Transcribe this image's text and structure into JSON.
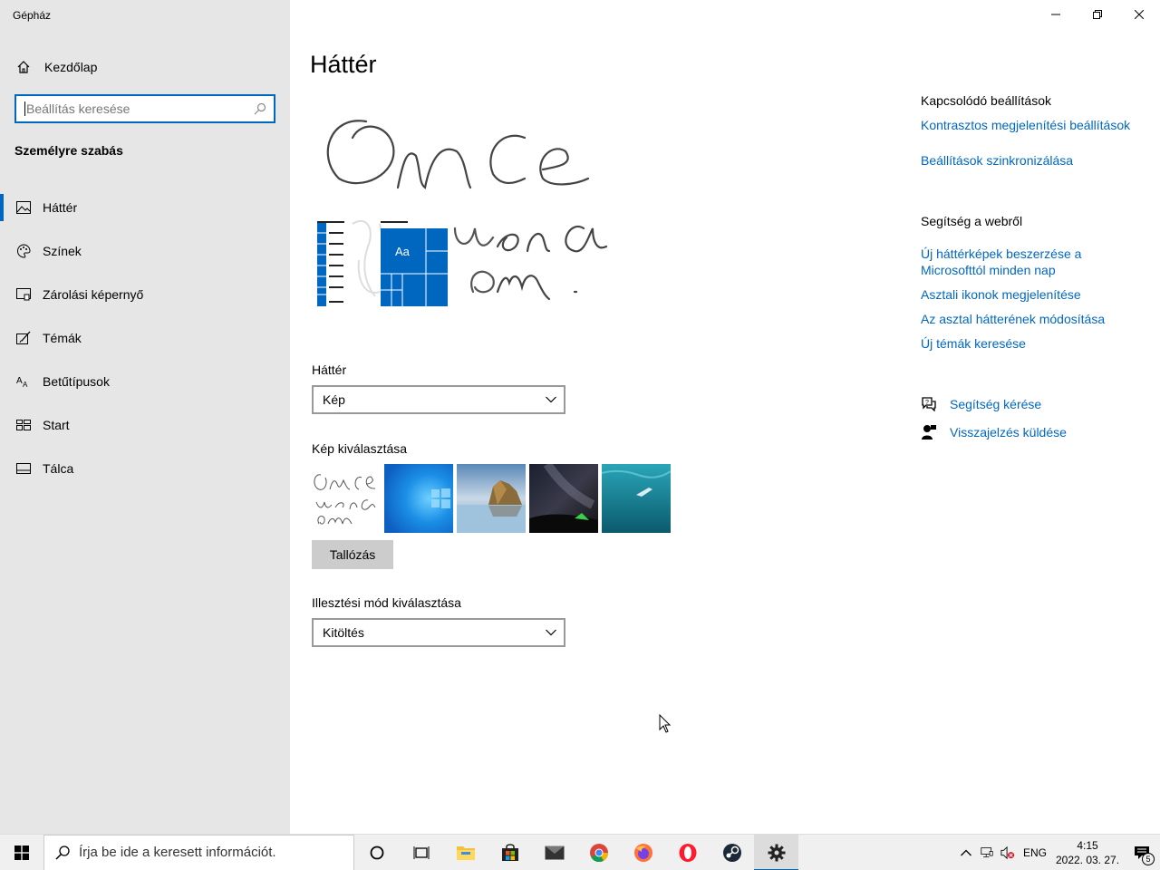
{
  "window": {
    "title": "Gépház",
    "controls": {
      "minimize": "minimize",
      "restore": "restore",
      "close": "close"
    }
  },
  "sidebar": {
    "home_label": "Kezdőlap",
    "search_placeholder": "Beállítás keresése",
    "section_title": "Személyre szabás",
    "items": [
      {
        "label": "Háttér",
        "icon": "image-icon",
        "active": true
      },
      {
        "label": "Színek",
        "icon": "palette-icon",
        "active": false
      },
      {
        "label": "Zárolási képernyő",
        "icon": "lock-screen-icon",
        "active": false
      },
      {
        "label": "Témák",
        "icon": "themes-icon",
        "active": false
      },
      {
        "label": "Betűtípusok",
        "icon": "fonts-icon",
        "active": false
      },
      {
        "label": "Start",
        "icon": "start-icon",
        "active": false
      },
      {
        "label": "Tálca",
        "icon": "taskbar-icon",
        "active": false
      }
    ]
  },
  "main": {
    "title": "Háttér",
    "preview": {
      "tile_label": "Aa",
      "handwriting": [
        "Once",
        "upon a",
        "dream ."
      ]
    },
    "background_label": "Háttér",
    "background_value": "Kép",
    "choose_picture_label": "Kép kiválasztása",
    "browse_button": "Tallózás",
    "fit_label": "Illesztési mód kiválasztása",
    "fit_value": "Kitöltés"
  },
  "related": {
    "heading": "Kapcsolódó beállítások",
    "links": [
      "Kontrasztos megjelenítési beállítások",
      "Beállítások szinkronizálása"
    ]
  },
  "web_help": {
    "heading": "Segítség a webről",
    "link1_line1": "Új háttérképek beszerzése a",
    "link1_line2": "Microsofttól minden nap",
    "links": [
      "Asztali ikonok megjelenítése",
      "Az asztal hátterének módosítása",
      "Új témák keresése"
    ]
  },
  "actions": {
    "get_help": "Segítség kérése",
    "feedback": "Visszajelzés küldése"
  },
  "taskbar": {
    "search_placeholder": "Írja be ide a keresett információt.",
    "language": "ENG",
    "time": "4:15",
    "date": "2022. 03. 27.",
    "notification_count": "5"
  },
  "colors": {
    "accent": "#0067c0",
    "sidebar_bg": "#e6e6e6",
    "taskbar_bg": "#f0f0f0"
  }
}
